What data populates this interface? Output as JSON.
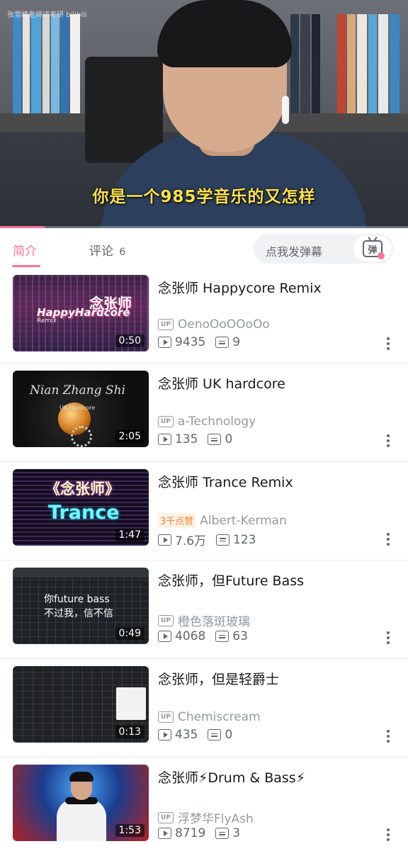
{
  "player": {
    "watermark": "张雪峰老师讲考研 bilibili",
    "subtitle": "你是一个985学音乐的又怎样",
    "progress_fraction": 0.11
  },
  "tabs": {
    "intro_label": "简介",
    "comment_label": "评论",
    "comment_count": "6"
  },
  "danmaku": {
    "placeholder": "点我发弹幕",
    "button_glyph": "弹"
  },
  "colors": {
    "accent": "#fb7299",
    "text_primary": "#18191c",
    "text_secondary": "#61666d",
    "text_tertiary": "#9499a0",
    "likes_orange": "#ff7f24"
  },
  "icons": {
    "up": "up-badge-icon",
    "play": "play-count-icon",
    "danmaku": "danmaku-count-icon",
    "more": "more-vertical-icon",
    "danmaku_send": "danmaku-send-icon"
  },
  "videos": [
    {
      "title": "念张师 Happycore Remix",
      "up_badge": "UP",
      "uploader": "OenoOoOOoOo",
      "views": "9435",
      "danmaku": "9",
      "duration": "0:50",
      "thumb_text": [
        "念张师",
        "HappyHardcore",
        "Remix"
      ]
    },
    {
      "title": "念张师 UK hardcore",
      "up_badge": "UP",
      "uploader": "a-Technology",
      "views": "135",
      "danmaku": "0",
      "duration": "2:05",
      "thumb_text": [
        "Nian Zhang Shi",
        "UK Hardcore"
      ]
    },
    {
      "title": "念张师 Trance Remix",
      "likes_badge": "3千点赞",
      "uploader": "Albert-Kerman",
      "views": "7.6万",
      "danmaku": "123",
      "duration": "1:47",
      "thumb_text": [
        "《念张师》",
        "Trance"
      ]
    },
    {
      "title": "念张师，但Future Bass",
      "up_badge": "UP",
      "uploader": "橙色落斑玻璃",
      "views": "4068",
      "danmaku": "63",
      "duration": "0:49",
      "thumb_text": [
        "你future bass",
        "不过我，信不信"
      ]
    },
    {
      "title": "念张师，但是轻爵士",
      "up_badge": "UP",
      "uploader": "Chemiscream",
      "views": "435",
      "danmaku": "0",
      "duration": "0:13"
    },
    {
      "title": "念张师⚡Drum & Bass⚡",
      "up_badge": "UP",
      "uploader": "浮梦华FlyAsh",
      "views": "8719",
      "danmaku": "3",
      "duration": "1:53"
    }
  ]
}
